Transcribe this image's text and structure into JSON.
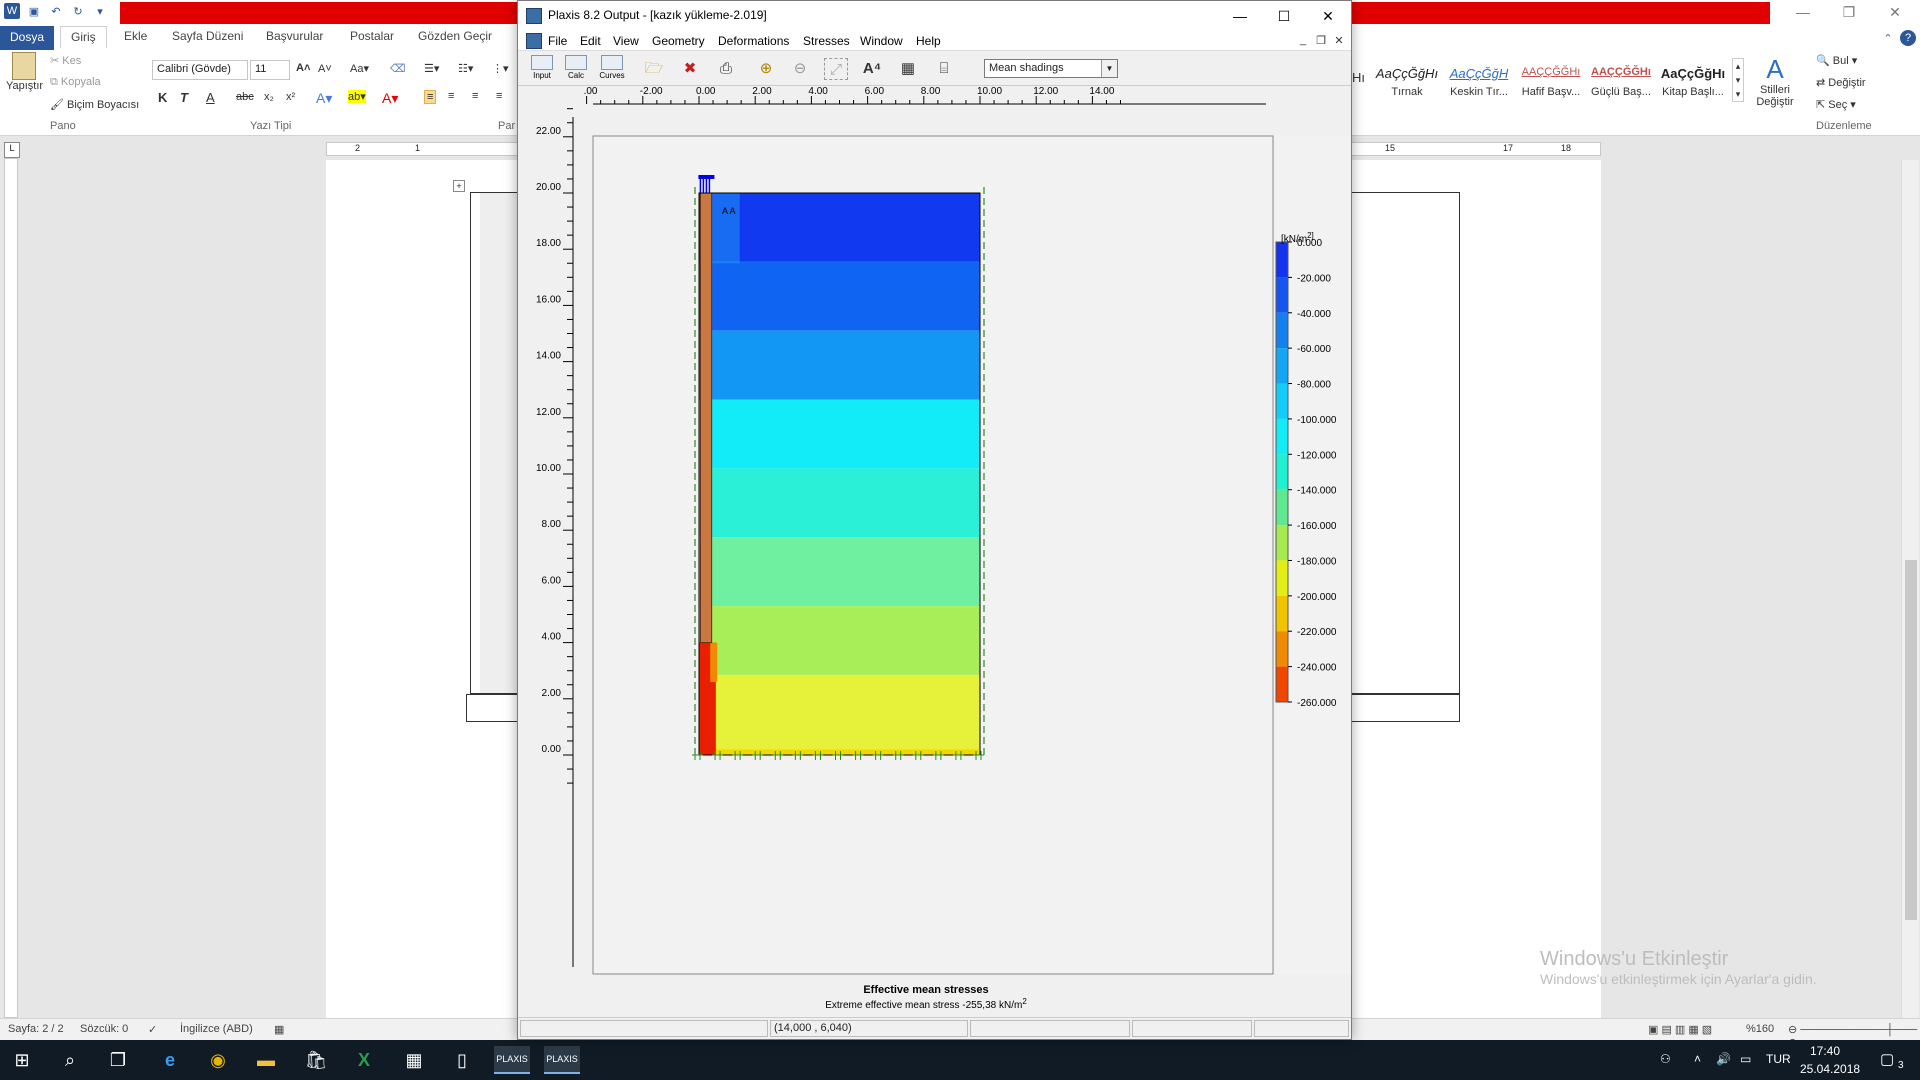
{
  "word": {
    "quick_access": [
      "save-icon",
      "undo-icon",
      "redo-icon"
    ],
    "tabs": [
      "Dosya",
      "Giriş",
      "Ekle",
      "Sayfa Düzeni",
      "Başvurular",
      "Postalar",
      "Gözden Geçir"
    ],
    "clipboard": {
      "paste": "Yapıştır",
      "cut": "Kes",
      "copy": "Kopyala",
      "format_painter": "Biçim Boyacısı",
      "group": "Pano"
    },
    "font": {
      "family": "Calibri (Gövde)",
      "size": "11",
      "group": "Yazı Tipi",
      "bold": "K",
      "italic": "T",
      "underline": "A",
      "strike": "abc",
      "sub": "x₂",
      "sup": "x²"
    },
    "paragraph_group": "Par",
    "styles": [
      {
        "sample": "AaÇçĞğHı",
        "label": "Tırnak"
      },
      {
        "sample": "AaÇçĞğH",
        "label": "Keskin Tır..."
      },
      {
        "sample": "AAÇÇĞĞHı",
        "label": "Hafif Başv..."
      },
      {
        "sample": "AAÇÇĞĞHı",
        "label": "Güçlü Baş..."
      },
      {
        "sample": "AaÇçĞğHı",
        "label": "Kitap Başlı..."
      }
    ],
    "styles_partial": "Hı",
    "change_styles": "Stilleri Değiştir",
    "editing": {
      "find": "Bul",
      "replace": "Değiştir",
      "select": "Seç",
      "group": "Düzenleme"
    },
    "ruler_marks": [
      "2",
      "1",
      "1",
      "15",
      "17",
      "18"
    ],
    "watermark": {
      "line1": "Windows'u Etkinleştir",
      "line2": "Windows'u etkinleştirmek için Ayarlar'a gidin."
    },
    "status": {
      "page": "Sayfa: 2 / 2",
      "words": "Sözcük: 0",
      "language": "İngilizce (ABD)",
      "zoom": "%160"
    }
  },
  "taskbar": {
    "apps": [
      "start-icon",
      "search-icon",
      "task-view-icon",
      "edge-icon",
      "chrome-icon",
      "file-explorer-icon",
      "store-icon",
      "excel-icon",
      "calculator-icon",
      "notepad-icon",
      "plaxis-input-icon",
      "plaxis-output-icon"
    ],
    "language": "TUR",
    "time": "17:40",
    "date": "25.04.2018",
    "notifications": "3"
  },
  "plaxis": {
    "title": "Plaxis 8.2 Output - [kazık yükleme-2.019]",
    "menu": [
      "File",
      "Edit",
      "View",
      "Geometry",
      "Deformations",
      "Stresses",
      "Window",
      "Help"
    ],
    "tool_buttons": [
      "Input",
      "Calc",
      "Curves"
    ],
    "display_mode": "Mean shadings",
    "status_coords": "(14,000 , 6,040)",
    "plot": {
      "title": "Effective mean stresses",
      "subtitle": "Extreme effective mean stress -255,38 kN/m",
      "subtitle_sup": "2",
      "unit": "[kN/m",
      "unit_sup": "2]",
      "point_label": "A  A"
    }
  },
  "chart_data": {
    "type": "heatmap",
    "title": "Effective mean stresses",
    "subtitle": "Extreme effective mean stress -255,38 kN/m2",
    "x_ticks": [
      ".00",
      "-2.00",
      "0.00",
      "2.00",
      "4.00",
      "6.00",
      "8.00",
      "10.00",
      "12.00",
      "14.00"
    ],
    "y_ticks": [
      "22.00",
      "20.00",
      "18.00",
      "16.00",
      "14.00",
      "12.00",
      "10.00",
      "8.00",
      "6.00",
      "4.00",
      "2.00",
      "0.00"
    ],
    "xlim": [
      -4,
      15
    ],
    "ylim": [
      -1,
      23
    ],
    "model": {
      "x": [
        0,
        10
      ],
      "y": [
        0,
        20
      ],
      "pile": {
        "x": [
          0.05,
          0.45
        ],
        "y": [
          4,
          20
        ]
      }
    },
    "legend": {
      "unit": "[kN/m2]",
      "values": [
        0,
        -20,
        -40,
        -60,
        -80,
        -100,
        -120,
        -140,
        -160,
        -180,
        -200,
        -220,
        -240,
        -260
      ],
      "labels": [
        "0.000",
        "-20.000",
        "-40.000",
        "-60.000",
        "-80.000",
        "-100.000",
        "-120.000",
        "-140.000",
        "-160.000",
        "-180.000",
        "-200.000",
        "-220.000",
        "-240.000",
        "-260.000"
      ],
      "colors": [
        "#1433ee",
        "#1555f0",
        "#1480f0",
        "#12a6f4",
        "#12cef6",
        "#12ecf4",
        "#1ef0d0",
        "#60e890",
        "#a6ea50",
        "#e4ee14",
        "#f0c400",
        "#f08a00",
        "#f04600",
        "#f00808"
      ]
    },
    "bands": [
      {
        "y": [
          17.55,
          20
        ],
        "stress": -20,
        "color": "#1039f0"
      },
      {
        "y": [
          15.1,
          17.55
        ],
        "stress": -40,
        "color": "#1064f2"
      },
      {
        "y": [
          12.65,
          15.1
        ],
        "stress": -60,
        "color": "#1298f4"
      },
      {
        "y": [
          10.2,
          12.65
        ],
        "stress": -80,
        "color": "#12ecf8"
      },
      {
        "y": [
          7.75,
          10.2
        ],
        "stress": -100,
        "color": "#2af0d8"
      },
      {
        "y": [
          5.3,
          7.75
        ],
        "stress": -120,
        "color": "#6ef0a0"
      },
      {
        "y": [
          2.85,
          5.3
        ],
        "stress": -140,
        "color": "#a8ee58"
      },
      {
        "y": [
          0.2,
          2.85
        ],
        "stress": -160,
        "color": "#e6f23a"
      },
      {
        "y": [
          0,
          0.2
        ],
        "stress": -180,
        "color": "#f0d800"
      }
    ]
  }
}
